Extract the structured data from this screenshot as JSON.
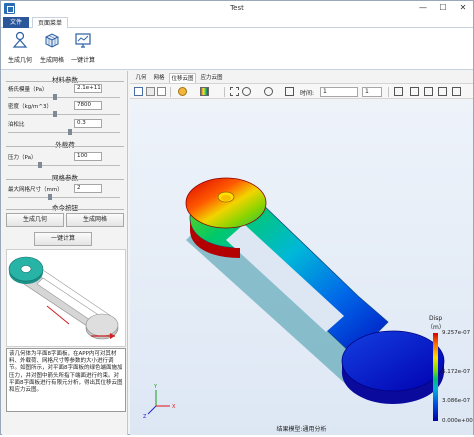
{
  "window": {
    "title": "Test",
    "minimize": "—",
    "maximize": "☐",
    "close": "✕"
  },
  "menubar": {
    "tabs": [
      "文件",
      "页面菜单"
    ]
  },
  "ribbon": {
    "buttons": [
      "生成几何",
      "生成网格",
      "一键计算"
    ]
  },
  "left_panel": {
    "material": {
      "title": "材料参数",
      "youngs_label": "杨氏模量（Pa）",
      "youngs_value": "2.1e+11",
      "density_label": "密度（kg/m^3）",
      "density_value": "7800",
      "poisson_label": "泊松比",
      "poisson_value": "0.3"
    },
    "load": {
      "title": "外载荷",
      "pressure_label": "压力（Pa）",
      "pressure_value": "100"
    },
    "mesh": {
      "title": "网格参数",
      "maxsize_label": "最大网格尺寸（mm）",
      "maxsize_value": "2"
    },
    "commands": {
      "title": "命令按钮",
      "gen_geometry": "生成几何",
      "gen_mesh": "生成网格",
      "compute": "一键计算"
    },
    "description": "该几何体为平面8字面板，在APP内可对其材料、外载荷、网格尺寸等参数的大小进行调节。如图所示，对平面8字面板的绿色端面施加压力，并对图中箭头所指下端面进行约束。对平面8字面板进行有限元分析，得出其位移云图和应力云图。"
  },
  "view": {
    "tabs": [
      "几何",
      "网格",
      "位移云图",
      "应力云图"
    ],
    "time_label": "时间:",
    "time_value": "1",
    "step_value": "1",
    "caption": "结果模型:通用分析",
    "legend": {
      "title": "Disp",
      "unit": "（m）",
      "ticks": [
        "9.257e-07",
        "6.172e-07",
        "3.086e-07",
        "0.000e+00"
      ]
    },
    "colors": {
      "max": "#d10000",
      "min": "#0000a0",
      "accent": "#2b579a"
    }
  }
}
